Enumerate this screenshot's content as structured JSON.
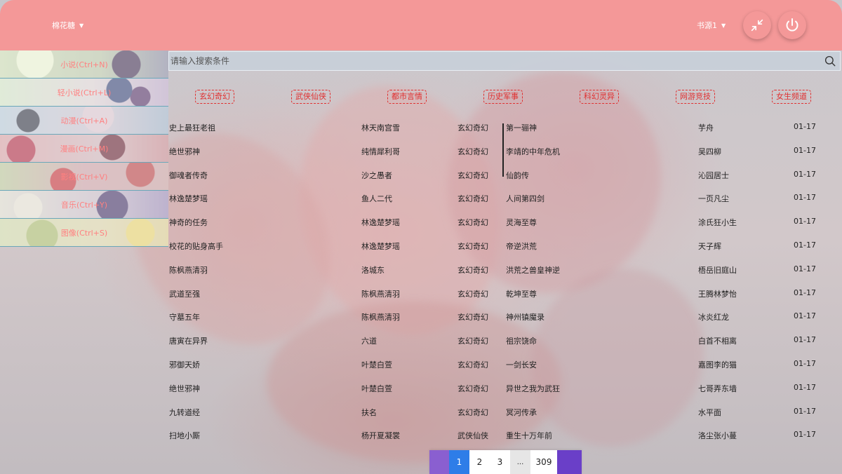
{
  "header": {
    "user_menu": "棉花糖",
    "source_menu": "书源1",
    "minimize_icon": "compress-arrows-icon",
    "power_icon": "power-icon"
  },
  "sidebar": {
    "items": [
      {
        "label": "小说(Ctrl+N)"
      },
      {
        "label": "轻小说(Ctrl+L)"
      },
      {
        "label": "动漫(Ctrl+A)"
      },
      {
        "label": "漫画(Ctrl+M)"
      },
      {
        "label": "影视(Ctrl+V)"
      },
      {
        "label": "音乐(Ctrl+Y)"
      },
      {
        "label": "图像(Ctrl+S)"
      }
    ]
  },
  "search": {
    "placeholder": "请输入搜索条件",
    "value": ""
  },
  "tabs": [
    "玄幻奇幻",
    "武侠仙侠",
    "都市言情",
    "历史军事",
    "科幻灵异",
    "网游竞技",
    "女生频道"
  ],
  "books": [
    {
      "title": "史上最狂老祖",
      "author": "林天南宫雪",
      "category": "玄幻奇幻",
      "chapter": "第一骊神",
      "updater": "芋舟",
      "date": "01-17"
    },
    {
      "title": "绝世邪神",
      "author": "纯情犀利哥",
      "category": "玄幻奇幻",
      "chapter": "李靖的中年危机",
      "updater": "吴四柳",
      "date": "01-17"
    },
    {
      "title": "御魂者传奇",
      "author": "沙之愚者",
      "category": "玄幻奇幻",
      "chapter": "仙韵传",
      "updater": "沁园居士",
      "date": "01-17"
    },
    {
      "title": "林逸楚梦瑶",
      "author": "鱼人二代",
      "category": "玄幻奇幻",
      "chapter": "人间第四剑",
      "updater": "一页凡尘",
      "date": "01-17"
    },
    {
      "title": "神奇的任务",
      "author": "林逸楚梦瑶",
      "category": "玄幻奇幻",
      "chapter": "灵海至尊",
      "updater": "涂氏狂小生",
      "date": "01-17"
    },
    {
      "title": "校花的贴身高手",
      "author": "林逸楚梦瑶",
      "category": "玄幻奇幻",
      "chapter": "帝逆洪荒",
      "updater": "天子辉",
      "date": "01-17"
    },
    {
      "title": "陈枫燕清羽",
      "author": "洛城东",
      "category": "玄幻奇幻",
      "chapter": "洪荒之兽皇神逆",
      "updater": "梧岳旧庭山",
      "date": "01-17"
    },
    {
      "title": "武道至强",
      "author": "陈枫燕清羽",
      "category": "玄幻奇幻",
      "chapter": "乾坤至尊",
      "updater": "王腾林梦怡",
      "date": "01-17"
    },
    {
      "title": "守墓五年",
      "author": "陈枫燕清羽",
      "category": "玄幻奇幻",
      "chapter": "神州镇魔录",
      "updater": "冰炎红龙",
      "date": "01-17"
    },
    {
      "title": "唐寅在异界",
      "author": "六道",
      "category": "玄幻奇幻",
      "chapter": "祖宗饶命",
      "updater": "白首不相离",
      "date": "01-17"
    },
    {
      "title": "邪御天娇",
      "author": "叶楚白萱",
      "category": "玄幻奇幻",
      "chapter": "一剑长安",
      "updater": "嘉图李的猫",
      "date": "01-17"
    },
    {
      "title": "绝世邪神",
      "author": "叶楚白萱",
      "category": "玄幻奇幻",
      "chapter": "异世之我为武狂",
      "updater": "七哥弄东墙",
      "date": "01-17"
    },
    {
      "title": "九转道经",
      "author": "扶名",
      "category": "玄幻奇幻",
      "chapter": "冥河传承",
      "updater": "水平面",
      "date": "01-17"
    },
    {
      "title": "扫地小厮",
      "author": "杨开夏凝裳",
      "category": "武侠仙侠",
      "chapter": "重生十万年前",
      "updater": "洛尘张小蔓",
      "date": "01-17"
    }
  ],
  "pagination": {
    "pages": [
      "1",
      "2",
      "3",
      "...",
      "309"
    ],
    "current": "1"
  },
  "colors": {
    "header": "#f49898",
    "tab_accent": "#e03030",
    "page_active": "#2e7de8",
    "sidebar_text": "#ff8080"
  }
}
